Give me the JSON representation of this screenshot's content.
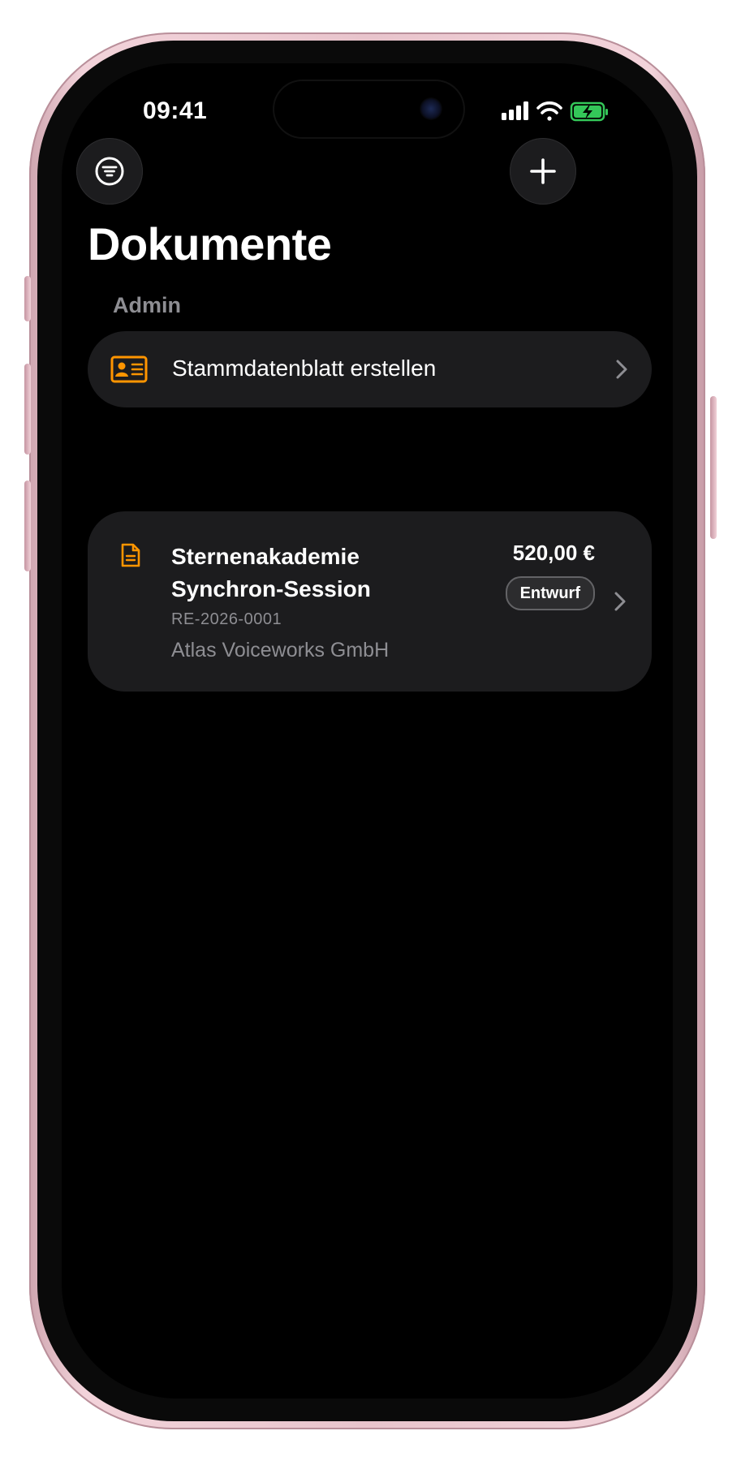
{
  "colors": {
    "accent": "#FF9500",
    "background": "#000000",
    "card": "#1C1C1E",
    "secondary_text": "#8E8E93",
    "battery": "#34C759"
  },
  "status_bar": {
    "time": "09:41",
    "icons": [
      "cellular-signal-icon",
      "wifi-icon",
      "battery-charging-icon"
    ]
  },
  "toolbar": {
    "filter_icon": "filter-icon",
    "add_icon": "plus-icon"
  },
  "page": {
    "title": "Dokumente"
  },
  "admin_section": {
    "header": "Admin",
    "row": {
      "icon": "id-card-icon",
      "label": "Stammdatenblatt erstellen"
    }
  },
  "documents": [
    {
      "icon": "document-icon",
      "title": "Sternenakademie Synchron-Session",
      "number": "RE-2026-0001",
      "client": "Atlas Voiceworks GmbH",
      "amount": "520,00 €",
      "status": "Entwurf"
    }
  ]
}
